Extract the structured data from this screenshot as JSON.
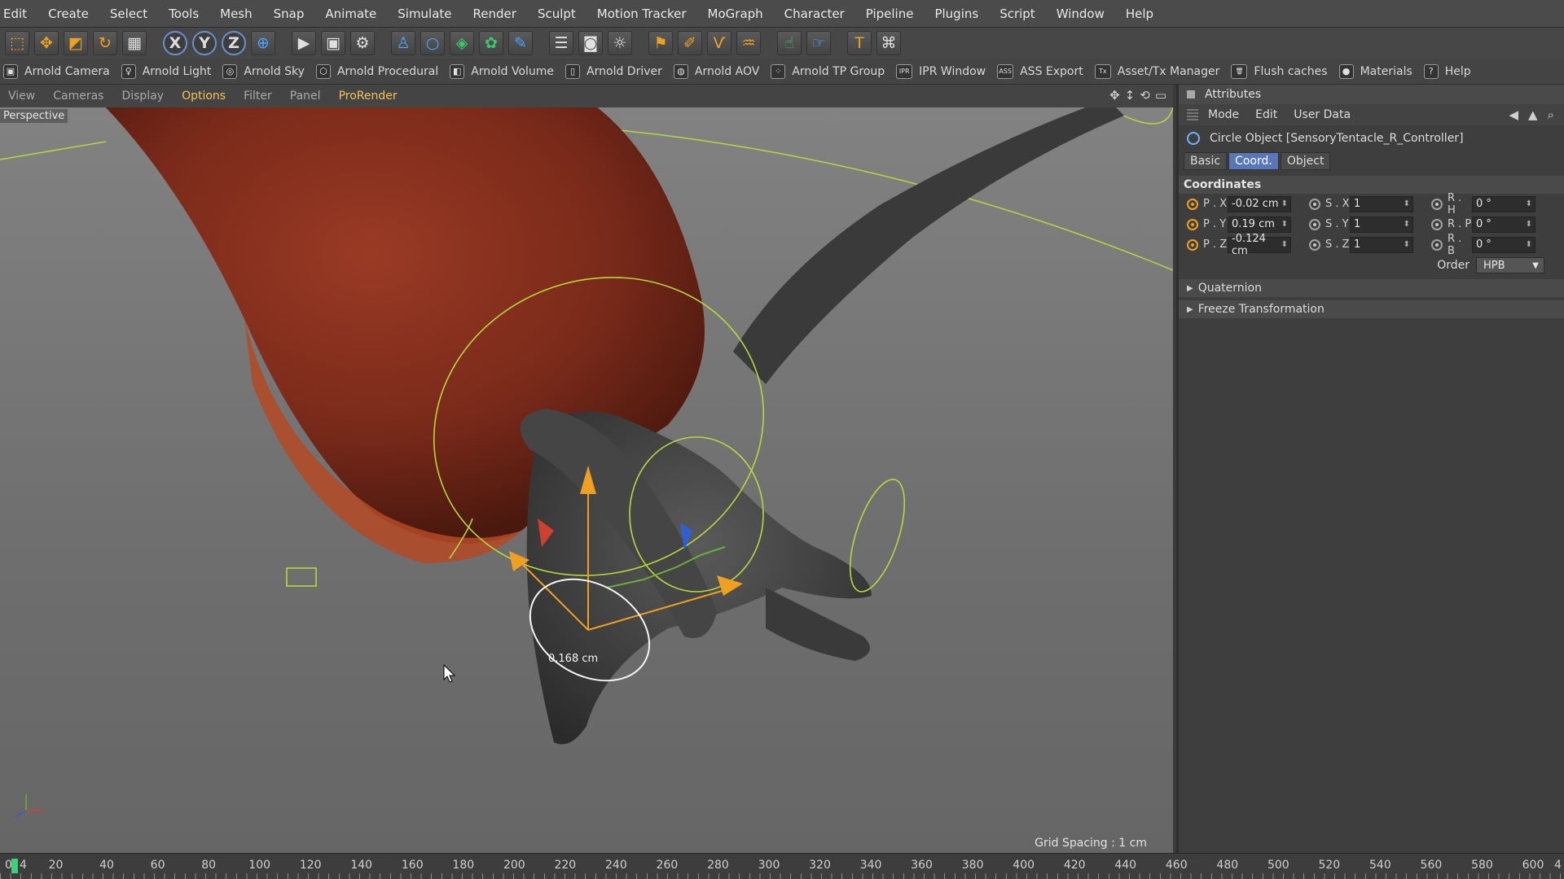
{
  "menu": [
    "Edit",
    "Create",
    "Select",
    "Tools",
    "Mesh",
    "Snap",
    "Animate",
    "Simulate",
    "Render",
    "Sculpt",
    "Motion Tracker",
    "MoGraph",
    "Character",
    "Pipeline",
    "Plugins",
    "Script",
    "Window",
    "Help"
  ],
  "toolbar": {
    "icons": [
      "live-selection-icon",
      "move-icon",
      "scale-icon",
      "rotate-icon",
      "recent-tools-icon",
      "x-axis-icon",
      "y-axis-icon",
      "z-axis-icon",
      "world-coordinate-icon",
      "render-view-icon",
      "render-picture-viewer-icon",
      "edit-render-settings-icon",
      "null-object-icon",
      "primitive-icon",
      "generator-icon",
      "deformer-icon",
      "spline-icon",
      "environment-icon",
      "camera-icon",
      "light-icon",
      "tag-icon",
      "sculpt-brush-icon",
      "paint-icon",
      "hair-icon",
      "text-icon",
      "goz-icon"
    ]
  },
  "arnold": [
    {
      "label": "Arnold Camera",
      "icon": "arnold-camera-icon"
    },
    {
      "label": "Arnold Light",
      "icon": "arnold-light-icon"
    },
    {
      "label": "Arnold Sky",
      "icon": "arnold-sky-icon"
    },
    {
      "label": "Arnold Procedural",
      "icon": "arnold-procedural-icon"
    },
    {
      "label": "Arnold Volume",
      "icon": "arnold-volume-icon"
    },
    {
      "label": "Arnold Driver",
      "icon": "arnold-driver-icon"
    },
    {
      "label": "Arnold AOV",
      "icon": "arnold-aov-icon"
    },
    {
      "label": "Arnold TP Group",
      "icon": "arnold-tp-group-icon"
    },
    {
      "label": "IPR Window",
      "icon": "ipr-icon"
    },
    {
      "label": "ASS Export",
      "icon": "ass-export-icon"
    },
    {
      "label": "Asset/Tx Manager",
      "icon": "tx-icon"
    },
    {
      "label": "Flush caches",
      "icon": "trash-icon"
    },
    {
      "label": "Materials",
      "icon": "materials-icon"
    },
    {
      "label": "Help",
      "icon": "help-icon"
    }
  ],
  "viewport": {
    "menu": [
      "View",
      "Cameras",
      "Display",
      "Options",
      "Filter",
      "Panel",
      "ProRender"
    ],
    "active_menu": "Options",
    "camera_label": "Perspective",
    "grid_spacing": "Grid Spacing : 1 cm",
    "measure_label": "0.168 cm"
  },
  "attributes": {
    "title": "Attributes",
    "menu": [
      "Mode",
      "Edit",
      "User Data"
    ],
    "object_line": "Circle Object [SensoryTentacle_R_Controller]",
    "tabs": [
      "Basic",
      "Coord.",
      "Object"
    ],
    "active_tab": "Coord.",
    "section": "Coordinates",
    "rows": [
      {
        "p_label": "P . X",
        "p_val": "-0.02 cm",
        "s_label": "S . X",
        "s_val": "1",
        "r_label": "R . H",
        "r_val": "0 °"
      },
      {
        "p_label": "P . Y",
        "p_val": "0.19 cm",
        "s_label": "S . Y",
        "s_val": "1",
        "r_label": "R . P",
        "r_val": "0 °"
      },
      {
        "p_label": "P . Z",
        "p_val": "-0.124 cm",
        "s_label": "S . Z",
        "s_val": "1",
        "r_label": "R . B",
        "r_val": "0 °"
      }
    ],
    "order_label": "Order",
    "order_value": "HPB",
    "subsections": [
      "Quaternion",
      "Freeze Transformation"
    ]
  },
  "timeline": {
    "ticks": [
      "0",
      "20",
      "40",
      "60",
      "80",
      "100",
      "120",
      "140",
      "160",
      "180",
      "200",
      "220",
      "240",
      "260",
      "280",
      "300",
      "320",
      "340",
      "360",
      "380",
      "400",
      "420",
      "440",
      "460",
      "480",
      "500",
      "520",
      "540",
      "560",
      "580",
      "600"
    ],
    "current_frame": "4",
    "end_frame": "4"
  },
  "colors": {
    "accent_orange": "#f0a020",
    "selection_green": "#b5d93a",
    "active_tab_blue": "#5877b9",
    "menu_highlight": "#f5c15a"
  }
}
